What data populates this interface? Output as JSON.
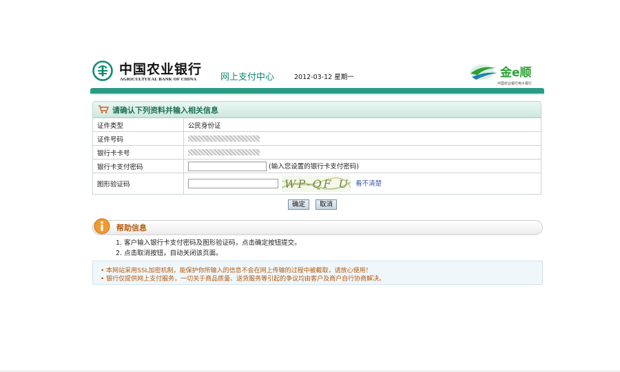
{
  "header": {
    "bank_name_cn": "中国农业银行",
    "bank_name_en": "AGRICULTUEAL BANK OF CHINA",
    "center_name": "网上支付中心",
    "date": "2012-03-12 星期一",
    "brand_name": "金e顺",
    "brand_sub": "中国农业银行电子银行",
    "logo_icon": "abc-bank-logo-icon",
    "colors": {
      "teal": "#2a9c86",
      "title_green": "#0e8b6e",
      "help_orange": "#b65c0c"
    }
  },
  "form": {
    "title": "请确认下列资料并输入相关信息",
    "rows": {
      "id_type_label": "证件类型",
      "id_type_value": "公民身份证",
      "id_number_label": "证件号码",
      "card_number_label": "银行卡卡号",
      "password_label": "银行卡支付密码",
      "password_hint": "(输入您设置的银行卡支付密码)",
      "captcha_label": "图形验证码",
      "captcha_text": "WP-QF U",
      "unclear_link": "看不清楚"
    },
    "buttons": {
      "confirm": "确定",
      "cancel": "取消"
    }
  },
  "help": {
    "title": "帮助信息",
    "items": [
      "1. 客户输入银行卡支付密码及图形验证码，点击确定按钮提交。",
      "2. 点击取消按钮，自动关闭该页面。"
    ]
  },
  "notices": [
    "• 本网站采用SSL加密机制，能保护你所输入的信息不会在网上传输的过程中被截取，请放心使用！",
    "• 银行仅提供网上支付服务，一切关于商品质量、送货服务等引起的争议均由客户及商户自行协商解决。"
  ]
}
